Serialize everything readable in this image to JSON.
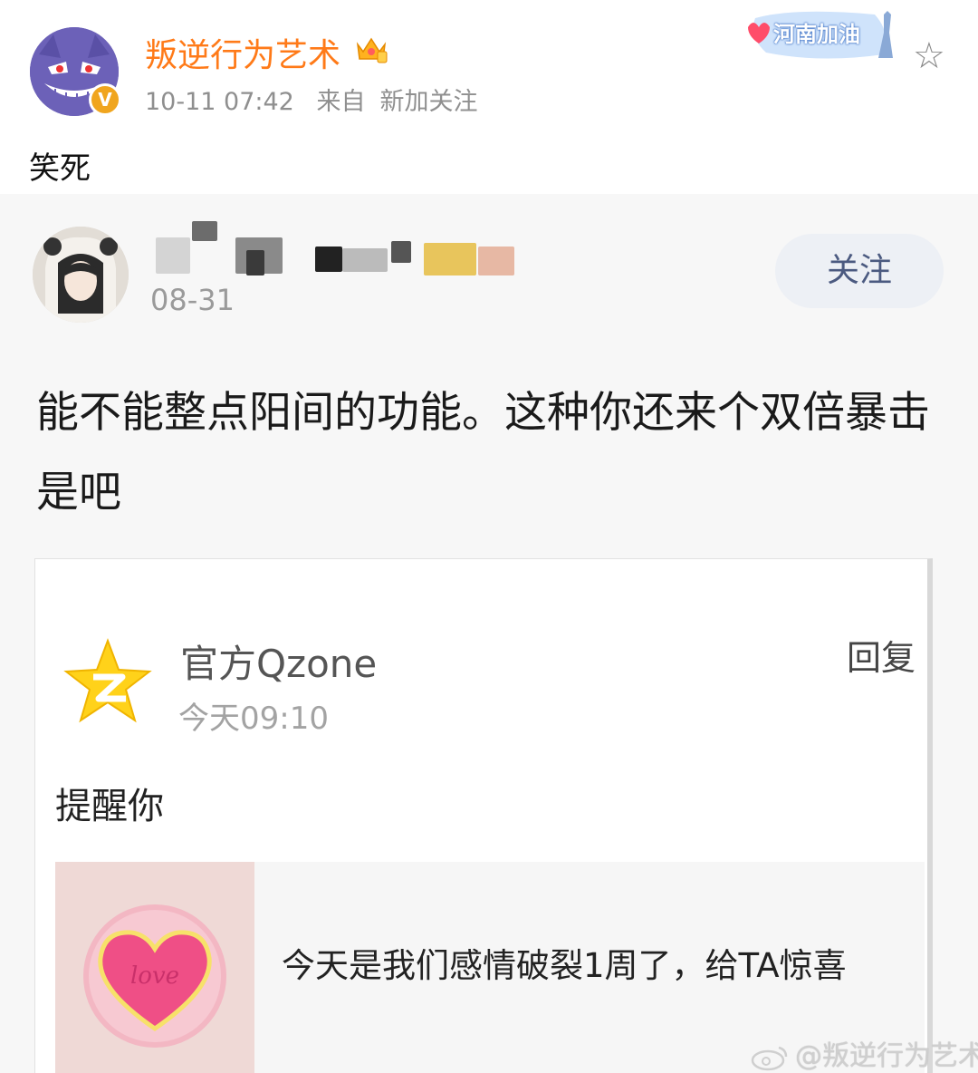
{
  "post": {
    "username": "叛逆行为艺术",
    "timestamp": "10-11 07:42",
    "source_label": "来自",
    "source_value": "新加关注",
    "text": "笑死",
    "card_badge": "河南加油"
  },
  "embedded": {
    "date": "08-31",
    "follow_label": "关注",
    "body": "能不能整点阳间的功能。这种你还来个双倍暴击是吧",
    "qzone": {
      "name": "官方Qzone",
      "time": "今天09:10",
      "reply_label": "回复",
      "remind": "提醒你",
      "notice": "今天是我们感情破裂1周了，给TA惊喜",
      "heart_text": "love"
    }
  },
  "watermark": "@叛逆行为艺术",
  "icons": [
    "verified-icon",
    "vip-crown-icon",
    "collect-star-icon",
    "qzone-star-icon",
    "love-heart-icon",
    "weibo-logo-icon"
  ],
  "colors": {
    "username": "#ff7a18",
    "follow_text": "#4b5a80",
    "badge": "#f0a51e"
  }
}
